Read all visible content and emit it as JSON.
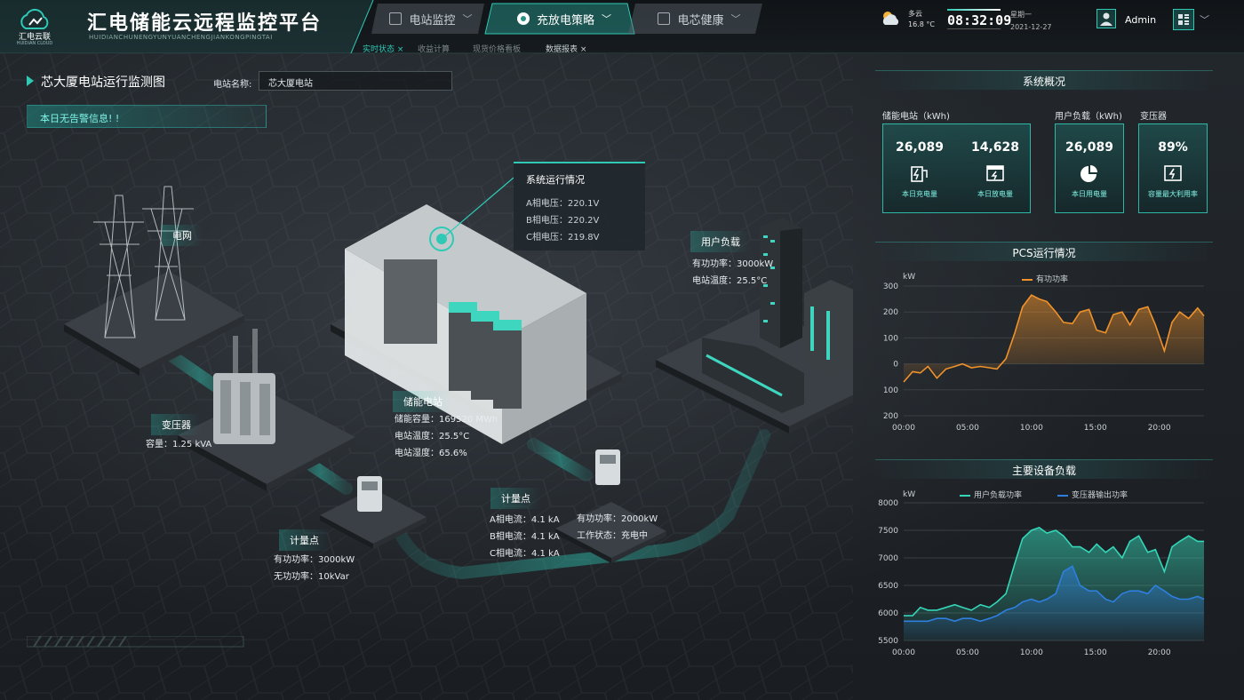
{
  "app": {
    "logo_text": "汇电云联",
    "logo_sub": "HUIDIAN CLOUD",
    "title": "汇电储能云远程监控平台",
    "title_pinyin": "HUIDIANCHUNENGYUNYUANCHENGJIANKONGPINGTAI"
  },
  "nav": {
    "tabs": [
      {
        "label": "电站监控",
        "icon": "monitor-icon"
      },
      {
        "label": "充放电策略",
        "icon": "strategy-icon",
        "active": true
      },
      {
        "label": "电芯健康",
        "icon": "battery-health-icon"
      }
    ],
    "subtabs": [
      {
        "label": "实时状态 ×",
        "active": true
      },
      {
        "label": "收益计算"
      },
      {
        "label": "现货价格看板"
      },
      {
        "label": "数据报表 ×"
      }
    ]
  },
  "status": {
    "weather_text": "多云",
    "temperature": "16.8 °C",
    "time": "08:32:09",
    "weekday": "星期一",
    "date": "2021-12-27",
    "user": "Admin"
  },
  "station": {
    "page_title": "芯大厦电站运行监测图",
    "name_label": "电站名称:",
    "name_value": "芯大厦电站",
    "alert": "本日无告警信息! !"
  },
  "diagram": {
    "grid_label": "电网",
    "transformer": {
      "label": "变压器",
      "capacity": "容量：1.25 kVA"
    },
    "meter1": {
      "label": "计量点",
      "active_power": "有功功率：3000kW",
      "reactive_power": "无功功率：10kVar"
    },
    "storage": {
      "label": "储能电站",
      "capacity": "储能容量：169520 MWh",
      "temp": "电站温度：25.5°C",
      "soc": "电站湿度：65.6%"
    },
    "meter2": {
      "label": "计量点",
      "a": "A相电流：4.1 kA",
      "b": "B相电流：4.1 kA",
      "c": "C相电流：4.1 kA"
    },
    "pcs": {
      "power": "有功功率：2000kW",
      "state": "工作状态：充电中"
    },
    "load": {
      "label": "用户负载",
      "power": "有功功率：3000kW",
      "temp": "电站温度：25.5°C"
    },
    "popup": {
      "title": "系统运行情况",
      "a": "A相电压：220.1V",
      "b": "B相电压：220.2V",
      "c": "C相电压：219.8V"
    }
  },
  "overview": {
    "title": "系统概况",
    "groups": [
      "储能电站（kWh)",
      "用户负载（kWh)",
      "变压器"
    ],
    "cards": [
      {
        "value": "26,089",
        "label": "本日充电量",
        "icon": "charge-icon"
      },
      {
        "value": "14,628",
        "label": "本日放电量",
        "icon": "discharge-icon"
      },
      {
        "value": "26,089",
        "label": "本日用电量",
        "icon": "pie-chart-icon"
      },
      {
        "value": "89%",
        "label": "容量最大利用率",
        "icon": "capacity-icon"
      }
    ]
  },
  "colors": {
    "accent": "#2fc9b6",
    "orange": "#f0922a",
    "teal": "#35d6b8",
    "blue": "#2f7fe0"
  },
  "chart_data": [
    {
      "type": "area",
      "title": "PCS运行情况",
      "unit": "kW",
      "x_ticks": [
        "00:00",
        "05:00",
        "10:00",
        "15:00",
        "20:00"
      ],
      "y_ticks": [
        "300",
        "200",
        "100",
        "0",
        "100",
        "200"
      ],
      "ylim": [
        -200,
        300
      ],
      "series": [
        {
          "name": "有功功率",
          "color": "#f0922a",
          "x": [
            0,
            0.7,
            1.3,
            1.9,
            2.6,
            3.3,
            4.0,
            4.6,
            5.3,
            6.0,
            6.7,
            7.3,
            8.0,
            8.7,
            9.3,
            10.0,
            10.6,
            11.2,
            11.9,
            12.5,
            13.2,
            13.8,
            14.5,
            15.1,
            15.8,
            16.4,
            17.1,
            17.7,
            18.4,
            19.1,
            19.7,
            20.4,
            21.0,
            21.6,
            22.3,
            23.0,
            23.5
          ],
          "y": [
            -70,
            -30,
            -35,
            -10,
            -55,
            -20,
            -10,
            0,
            -15,
            -10,
            -15,
            -20,
            20,
            120,
            220,
            265,
            250,
            240,
            200,
            160,
            155,
            200,
            210,
            130,
            120,
            190,
            200,
            150,
            210,
            220,
            150,
            50,
            160,
            200,
            175,
            215,
            185
          ]
        }
      ]
    },
    {
      "type": "area",
      "title": "主要设备负载",
      "unit": "kW",
      "x_ticks": [
        "00:00",
        "05:00",
        "10:00",
        "15:00",
        "20:00"
      ],
      "y_ticks": [
        "8000",
        "7500",
        "7000",
        "6500",
        "6000",
        "5500"
      ],
      "ylim": [
        5500,
        8000
      ],
      "series": [
        {
          "name": "用户负载功率",
          "color": "#35d6b8",
          "x": [
            0,
            0.7,
            1.3,
            1.9,
            2.6,
            3.3,
            4.0,
            4.6,
            5.3,
            6.0,
            6.7,
            7.3,
            8.0,
            8.7,
            9.3,
            10.0,
            10.6,
            11.2,
            11.9,
            12.5,
            13.2,
            13.8,
            14.5,
            15.1,
            15.8,
            16.4,
            17.1,
            17.7,
            18.4,
            19.1,
            19.7,
            20.4,
            21.0,
            21.6,
            22.3,
            23.0,
            23.5
          ],
          "y": [
            5950,
            5950,
            6100,
            6050,
            6050,
            6100,
            6150,
            6100,
            6050,
            6150,
            6100,
            6200,
            6350,
            6900,
            7350,
            7500,
            7550,
            7450,
            7500,
            7400,
            7200,
            7200,
            7100,
            7250,
            7100,
            7200,
            7000,
            7300,
            7400,
            7100,
            7150,
            6750,
            7200,
            7300,
            7400,
            7300,
            7300
          ]
        },
        {
          "name": "变压器输出功率",
          "color": "#2f7fe0",
          "x": [
            0,
            0.7,
            1.3,
            1.9,
            2.6,
            3.3,
            4.0,
            4.6,
            5.3,
            6.0,
            6.7,
            7.3,
            8.0,
            8.7,
            9.3,
            10.0,
            10.6,
            11.2,
            11.9,
            12.5,
            13.2,
            13.8,
            14.5,
            15.1,
            15.8,
            16.4,
            17.1,
            17.7,
            18.4,
            19.1,
            19.7,
            20.4,
            21.0,
            21.6,
            22.3,
            23.0,
            23.5
          ],
          "y": [
            5850,
            5850,
            5850,
            5850,
            5900,
            5900,
            5850,
            5900,
            5900,
            5850,
            5900,
            5950,
            6050,
            6100,
            6200,
            6250,
            6200,
            6250,
            6350,
            6750,
            6850,
            6500,
            6400,
            6400,
            6250,
            6200,
            6350,
            6400,
            6400,
            6350,
            6500,
            6400,
            6300,
            6250,
            6250,
            6300,
            6250
          ]
        }
      ]
    }
  ]
}
